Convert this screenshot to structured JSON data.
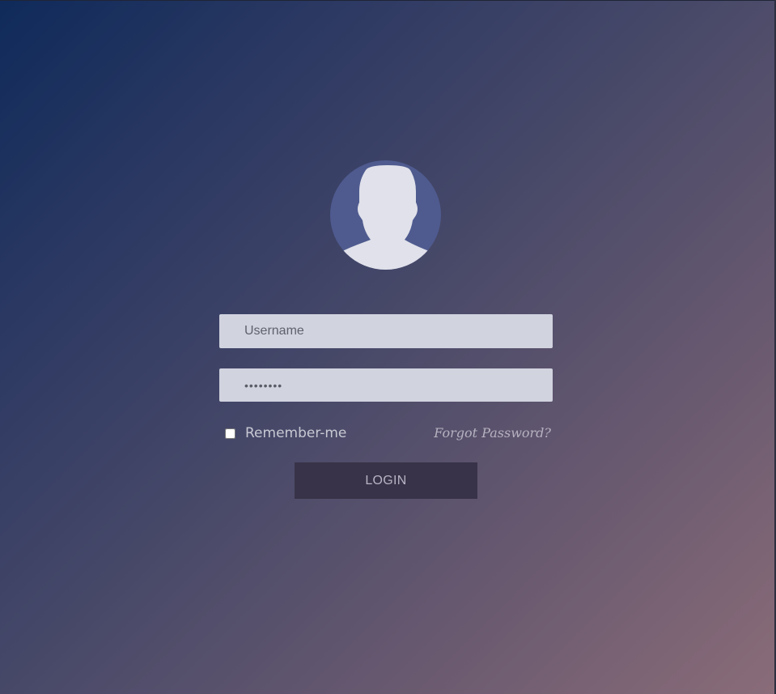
{
  "avatar": {
    "icon": "user-silhouette-icon",
    "circle_color": "#4f5b8f",
    "figure_color": "#e0e1ea"
  },
  "form": {
    "username": {
      "placeholder": "Username",
      "value": ""
    },
    "password": {
      "value": "password"
    },
    "remember_me": {
      "label": "Remember-me",
      "checked": false
    },
    "forgot_password_label": "Forgot Password?",
    "login_label": "LOGIN"
  },
  "colors": {
    "gradient_start": "#0f2a5a",
    "gradient_end": "#8a6c78",
    "input_bg": "#d1d3df",
    "button_bg": "#383348"
  }
}
